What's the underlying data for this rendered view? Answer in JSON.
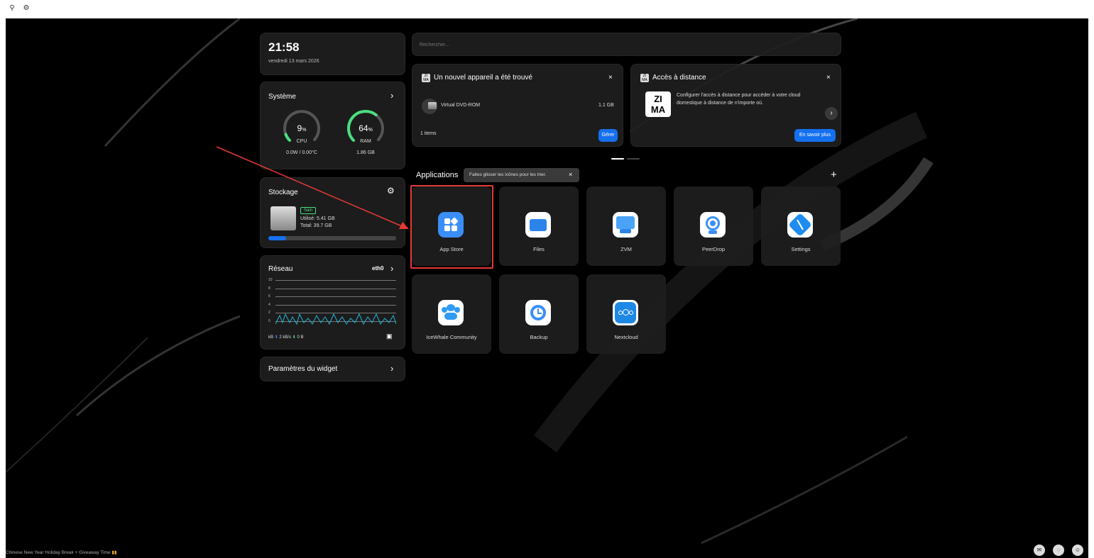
{
  "topbar": {
    "icons": [
      "people-icon",
      "gear-icon"
    ]
  },
  "clock": {
    "time": "21:58",
    "date": "vendredi 13 mars 2026"
  },
  "system": {
    "title": "Système",
    "cpu_value": "9",
    "cpu_unit": "%",
    "cpu_label": "CPU",
    "cpu_sub": "0.0W / 0.00°C",
    "ram_value": "64",
    "ram_unit": "%",
    "ram_label": "RAM",
    "ram_sub": "1.86 GB",
    "cpu_fraction": 0.09,
    "ram_fraction": 0.64
  },
  "storage": {
    "title": "Stockage",
    "status": "Sain",
    "used": "Utilisé: 5.41 GB",
    "total": "Total: 39.7 GB",
    "used_fraction": 0.14
  },
  "network": {
    "title": "Réseau",
    "iface": "eth0",
    "y_ticks": [
      "10",
      "8",
      "6",
      "4",
      "2",
      "0"
    ],
    "unit": "kB",
    "up": "2 kB/s",
    "down": "0 B"
  },
  "widget_settings": {
    "label": "Paramètres du widget"
  },
  "search": {
    "placeholder": "Rechercher..."
  },
  "device_card": {
    "title": "Un nouvel appareil a été trouvé",
    "device": "Virtual DVD-ROM",
    "size": "1.1 GB",
    "count": "1 items",
    "button": "Gérer"
  },
  "remote_card": {
    "title": "Accès à distance",
    "text1": "Configurer l'accès à distance pour accéder à votre cloud",
    "text2": "domestique à distance de n'importe où.",
    "button": "En savoir plus",
    "logo1": "ZI",
    "logo2": "MA"
  },
  "apps": {
    "title": "Applications",
    "hint": "Faites glisser les icônes pour les trier.",
    "items": [
      {
        "label": "App Store",
        "color": "#3a8ef6"
      },
      {
        "label": "Files",
        "color": "#2b84ea"
      },
      {
        "label": "ZVM",
        "color": "#4aa3f7"
      },
      {
        "label": "PeerDrop",
        "color": "#ffffff"
      },
      {
        "label": "Settings",
        "color": "#1f8cf0"
      },
      {
        "label": "IceWhale Community",
        "color": "#2f9bf5"
      },
      {
        "label": "Backup",
        "color": "#ffffff"
      },
      {
        "label": "Nextcloud",
        "color": "#1e88e5"
      }
    ]
  },
  "footer": {
    "news": "Chinese New Year Holiday Break + Giveaway Time",
    "icons": [
      "mail-icon",
      "chat-icon",
      "user-icon"
    ]
  },
  "colors": {
    "accent": "#1570ef",
    "gauge_green": "#4ade80",
    "annotation_red": "#e53935"
  }
}
